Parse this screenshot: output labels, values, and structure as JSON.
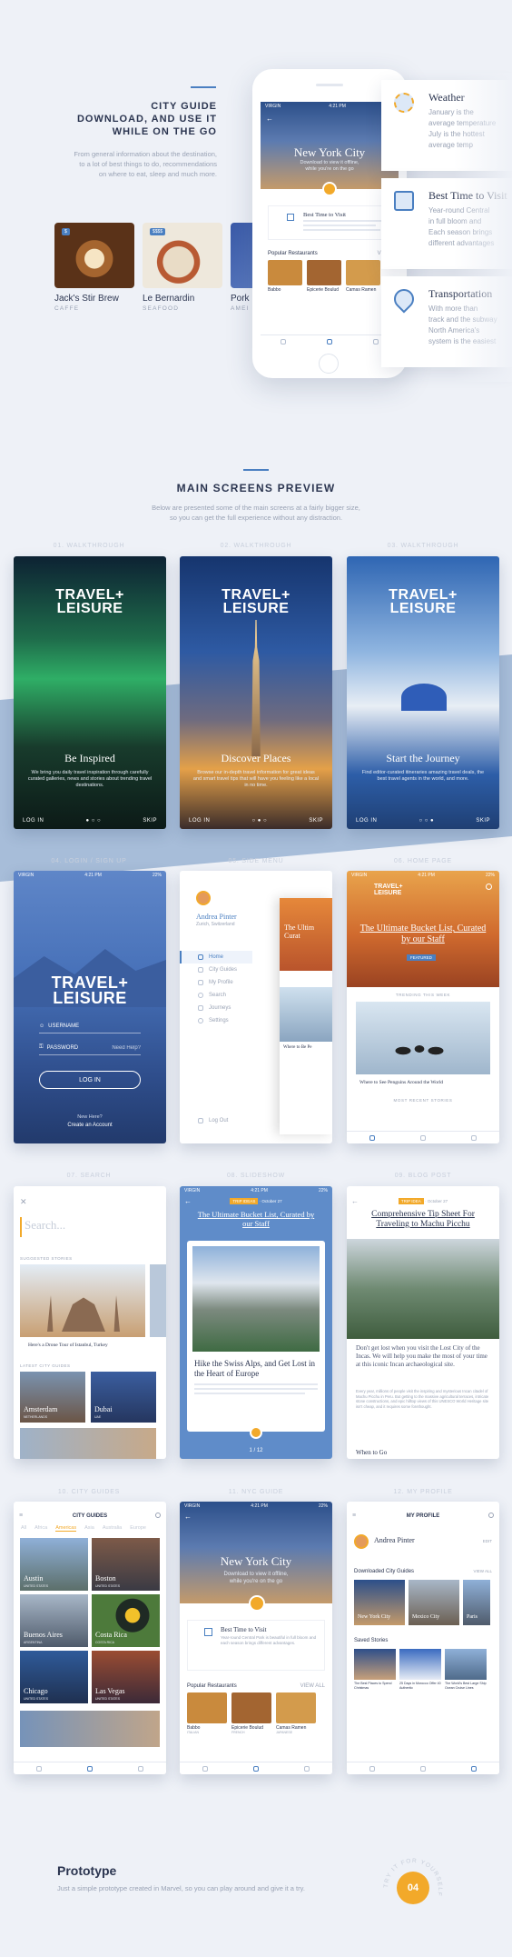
{
  "hero": {
    "title_lines": [
      "CITY GUIDE",
      "DOWNLOAD, AND USE IT",
      "WHILE ON THE GO"
    ],
    "desc_lines": [
      "From general information about the destination,",
      "to a lot of best things to do, recommendations",
      "on where to eat, sleep and much more."
    ],
    "restaurants": [
      {
        "name": "Jack's Stir Brew",
        "category": "CAFFE",
        "price": "$"
      },
      {
        "name": "Le Bernardin",
        "category": "SEAFOOD",
        "price": "$$$$"
      },
      {
        "name": "Pork",
        "category": "AMEI",
        "price": ""
      }
    ]
  },
  "hero_phone": {
    "status": "VIRGIN",
    "time": "4:21 PM",
    "city": "New York City",
    "sub": "Download to view it offline,",
    "sub2": "while you're on the go",
    "visit_title": "Best Time to Visit",
    "popular": "Popular Restaurants",
    "view_all": "VIEW",
    "restaurants": [
      "Babbo",
      "Epicerie Boulud",
      "Camas Ramen"
    ],
    "rest_cats": [
      "ITALIAN",
      "FRENCH",
      "JAPANESE"
    ]
  },
  "info_cards": [
    {
      "title": "Weather",
      "lines": [
        "January is the",
        "average temperature",
        "July is the hottest",
        "average temp"
      ]
    },
    {
      "title": "Best Time to Visit",
      "lines": [
        "Year-round Central",
        "in full bloom and",
        "Each season brings",
        "different advantages"
      ]
    },
    {
      "title": "Transportation",
      "lines": [
        "With more than",
        "track and the subway",
        "North America's",
        "system is the easiest"
      ]
    }
  ],
  "preview": {
    "title": "MAIN SCREENS PREVIEW",
    "desc_lines": [
      "Below are presented some of the main screens at a fairly bigger size,",
      "so you can get the full experience without any distraction."
    ]
  },
  "screens": {
    "labels": [
      "01. WALKTHROUGH",
      "02. WALKTHROUGH",
      "03. WALKTHROUGH",
      "04. LOGIN / SIGN UP",
      "05. SIDE MENU",
      "06. HOME PAGE",
      "07. SEARCH",
      "08. SLIDESHOW",
      "09. BLOG POST",
      "10. CITY GUIDES",
      "11. NYC GUIDE",
      "12. MY PROFILE"
    ],
    "logo_line1": "TRAVEL+",
    "logo_line2": "LEISURE",
    "walk": [
      {
        "title": "Be Inspired",
        "desc": "We bring you daily travel inspiration through carefully curated galleries, news and stories about trending travel destinations."
      },
      {
        "title": "Discover Places",
        "desc": "Browse our in-depth travel information for great ideas and smart travel tips that will have you feeling like a local in no time."
      },
      {
        "title": "Start the Journey",
        "desc": "Find editor-curated itineraries amazing travel deals, the best travel agents in the world, and more."
      }
    ],
    "login": "LOG IN",
    "skip": "SKIP",
    "login_screen": {
      "status": "VIRGIN",
      "time": "4:21 PM",
      "battery": "22%",
      "username": "USERNAME",
      "password": "PASSWORD",
      "need_help": "Need Help?",
      "login_btn": "LOG IN",
      "new_here": "New Here?",
      "create": "Create an Account"
    },
    "menu": {
      "name": "Andrea Pinter",
      "location": "Zurich, Switzerland",
      "items": [
        "Home",
        "City Guides",
        "My Profile",
        "Search",
        "Journeys",
        "Settings"
      ],
      "logout": "Log Out",
      "peek_title": "The Ultim",
      "peek_title2": "Curat",
      "peek_caption": "Where to Be Pe"
    },
    "home": {
      "headline": "The Ultimate Bucket List, Curated by our Staff",
      "badge": "FEATURED",
      "trending": "TRENDING THIS WEEK",
      "caption": "Where to See Penguins Around the World",
      "recent": "MOST RECENT STORIES"
    },
    "search": {
      "placeholder": "Search...",
      "suggested": "SUGGESTED STORIES",
      "story": "Here's a Drone Tour of Istanbul, Turkey",
      "latest": "LATEST CITY GUIDES",
      "cities": [
        "Amsterdam",
        "Dubai"
      ],
      "countries": [
        "NETHERLANDS",
        "UAE"
      ]
    },
    "slideshow": {
      "tag": "TRIP IDEAS",
      "date": "October 27",
      "title": "The Ultimate Bucket List, Curated by our Staff",
      "card_title": "Hike the Swiss Alps, and Get Lost in the Heart of Europe",
      "counter": "1 / 12"
    },
    "blog": {
      "tag": "TRIP IDEA",
      "date": "October 27",
      "title": "Comprehensive Tip Sheet For Traveling to Machu Picchu",
      "lead": "Don't get lost when you visit the Lost City of the Incas. We will help you make the most of your time at this iconic Incan archaeological site.",
      "body": "Every year, millions of people visit the inspiring and mysterious Incan citadel of Machu Picchu in Peru. But getting to the massive agricultural terraces, intricate stone constructions, and epic hilltop views of this UNESCO World Heritage site isn't cheap, and it requires some forethought.",
      "subhead": "When to Go"
    },
    "guides": {
      "title": "CITY GUIDES",
      "tabs": [
        "All",
        "Africa",
        "Americas",
        "Asia",
        "Australia",
        "Europe"
      ],
      "cities": [
        {
          "name": "Austin",
          "country": "UNITED STATES"
        },
        {
          "name": "Boston",
          "country": "UNITED STATES"
        },
        {
          "name": "Buenos Aires",
          "country": "ARGENTINA"
        },
        {
          "name": "Costa Rica",
          "country": "COSTA RICA"
        },
        {
          "name": "Chicago",
          "country": "UNITED STATES"
        },
        {
          "name": "Las Vegas",
          "country": "UNITED STATES"
        }
      ]
    },
    "nyc": {
      "city": "New York City",
      "sub": "Download to view it offline,",
      "sub2": "while you're on the go",
      "visit": "Best Time to Visit",
      "visit_text": "Year-round Central Park is beautiful in full bloom and each season brings different advantages.",
      "popular": "Popular Restaurants",
      "view_all": "VIEW ALL",
      "restaurants": [
        "Babbo",
        "Epicerie Boulud",
        "Camas Ramen"
      ],
      "rest_cats": [
        "ITALIAN",
        "FRENCH",
        "JAPANESE"
      ]
    },
    "profile": {
      "title": "MY PROFILE",
      "name": "Andrea Pinter",
      "edit": "EDIT",
      "downloaded": "Downloaded City Guides",
      "view_all": "VIEW ALL",
      "cities": [
        "New York City",
        "Mexico City",
        "Paris"
      ],
      "saved": "Saved Stories",
      "stories": [
        "The Best Places to Spend Christmas",
        "25 Days in Morocco Offer 40 Authentic",
        "The World's Best Large Ship Ocean Cruise Lines"
      ]
    }
  },
  "prototype": {
    "title": "Prototype",
    "desc": "Just a simple prototype created in Marvel, so you can play around and give it a try.",
    "ring_text": "TRY IT FOR YOURSELF",
    "number": "04"
  },
  "colors": {
    "accent": "#4a7fc1",
    "gold": "#f2a92a",
    "navy": "#2b3550"
  }
}
